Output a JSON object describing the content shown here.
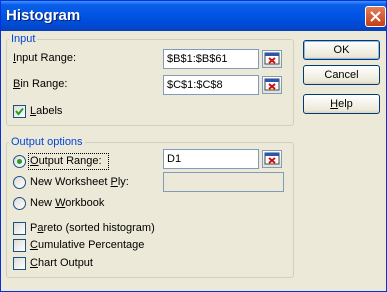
{
  "window": {
    "title": "Histogram"
  },
  "input_group": {
    "legend": "Input",
    "input_range_label": {
      "pre": "",
      "u": "I",
      "post": "nput Range:"
    },
    "input_range_value": "$B$1:$B$61",
    "bin_range_label": {
      "pre": "",
      "u": "B",
      "post": "in Range:"
    },
    "bin_range_value": "$C$1:$C$8",
    "labels_label": {
      "pre": "",
      "u": "L",
      "post": "abels"
    },
    "labels_checked": true
  },
  "buttons": {
    "ok": "OK",
    "cancel": "Cancel",
    "help": {
      "pre": "",
      "u": "H",
      "post": "elp"
    }
  },
  "output_group": {
    "legend": "Output options",
    "output_range_label": {
      "pre": "",
      "u": "O",
      "post": "utput Range:"
    },
    "output_range_value": "D1",
    "new_worksheet_label": {
      "pre": "New Worksheet ",
      "u": "P",
      "post": "ly:"
    },
    "new_worksheet_value": "",
    "new_workbook_label": {
      "pre": "New ",
      "u": "W",
      "post": "orkbook"
    },
    "pareto_label": {
      "pre": "P",
      "u": "a",
      "post": "reto (sorted histogram)"
    },
    "cumulative_label": {
      "pre": "",
      "u": "C",
      "post": "umulative Percentage"
    },
    "chart_output_label": {
      "pre": "",
      "u": "C",
      "post": "hart Output"
    },
    "selected_option": "output-range"
  },
  "icons": {
    "close": "close-icon",
    "collapse": "collapse-dialog-icon",
    "check": "check-icon"
  },
  "colors": {
    "title_bar": "#0054e3",
    "legend_text": "#0046d5",
    "radio_dot": "#2a9b2a",
    "window_bg": "#ece9d8"
  }
}
